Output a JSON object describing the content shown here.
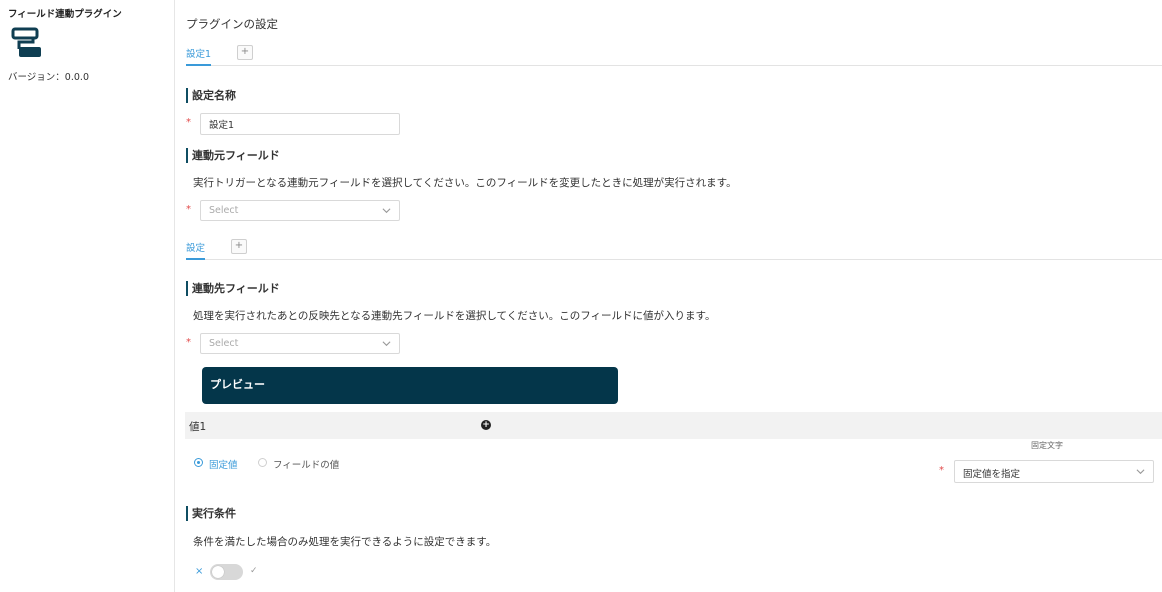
{
  "sidebar": {
    "plugin_name": "フィールド連動プラグイン",
    "logo_icon": "plugin-logo-icon",
    "version": "バージョン：0.0.0"
  },
  "main": {
    "title": "プラグインの設定",
    "tabs": [
      {
        "label": "設定1",
        "selected": true
      }
    ],
    "tab_add": "+",
    "setting_name": {
      "heading": "設定名称",
      "required_mark": "*",
      "value": "設定1"
    },
    "source_field": {
      "heading": "連動元フィールド",
      "description": "実行トリガーとなる連動元フィールドを選択してください。このフィールドを変更したときに処理が実行されます。",
      "required_mark": "*",
      "placeholder": "Select"
    },
    "sub_tabs": [
      {
        "label": "設定",
        "selected": true
      }
    ],
    "sub_tab_add": "+",
    "target_field": {
      "heading": "連動先フィールド",
      "description": "処理を実行されたあとの反映先となる連動先フィールドを選択してください。このフィールドに値が入ります。",
      "required_mark": "*",
      "placeholder": "Select"
    },
    "preview": {
      "label": "プレビュー"
    },
    "value_row": {
      "label": "値1",
      "add_icon": "+"
    },
    "value_type": {
      "options": [
        {
          "label": "固定値",
          "selected": true
        },
        {
          "label": "フィールドの値",
          "selected": false
        }
      ]
    },
    "fixed_text": {
      "label": "固定文字",
      "required_mark": "*",
      "value": "固定値を指定"
    },
    "condition": {
      "heading": "実行条件",
      "description": "条件を満たした場合のみ処理を実行できるように設定できます。",
      "toggle_enabled": false,
      "off_mark": "×",
      "on_mark": "✓"
    }
  },
  "colors": {
    "accent": "#3a9ad9",
    "brand_dark": "#04364a",
    "required": "#e24a4a",
    "heading_bar": "#0f4d62"
  }
}
